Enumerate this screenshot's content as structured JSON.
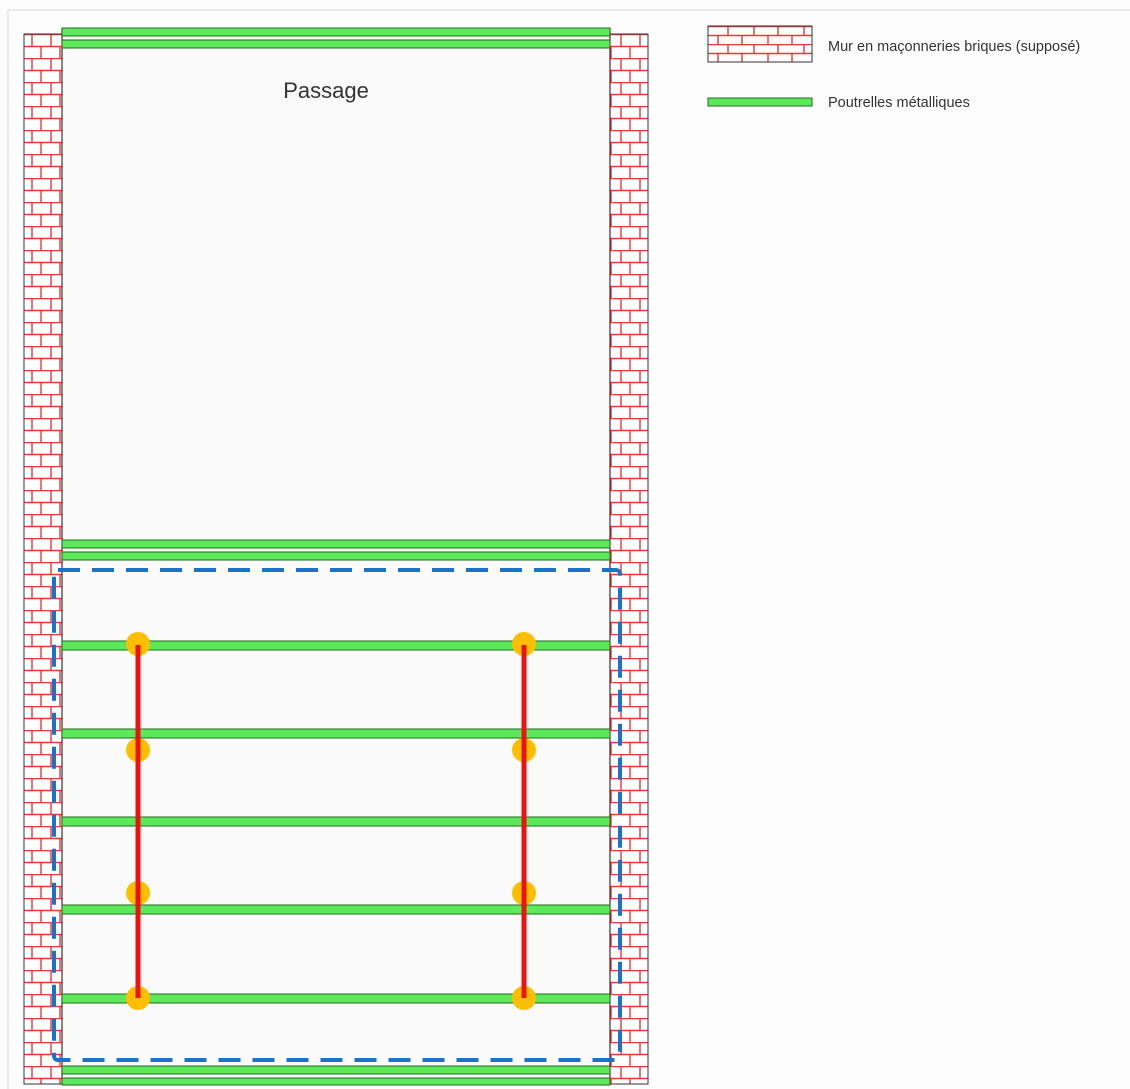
{
  "room": {
    "label": "Passage"
  },
  "legend": {
    "wall_label": "Mur en maçonneries briques (supposé)",
    "beam_label": "Poutrelles métalliques"
  },
  "colors": {
    "background": "#fdfdfd",
    "brick_line": "#e8383a",
    "wall_frame": "#333333",
    "beam_fill": "#5ee85c",
    "beam_stroke": "#1f6e1e",
    "zone_dash": "#1a73c8",
    "tie_rod": "#ee1111",
    "anchor_dot": "#ffbf00",
    "text": "#333333",
    "frame": "#d8d8d8"
  },
  "icons": {
    "wall_swatch": "brick-wall-icon",
    "beam_swatch": "steel-beam-icon"
  }
}
